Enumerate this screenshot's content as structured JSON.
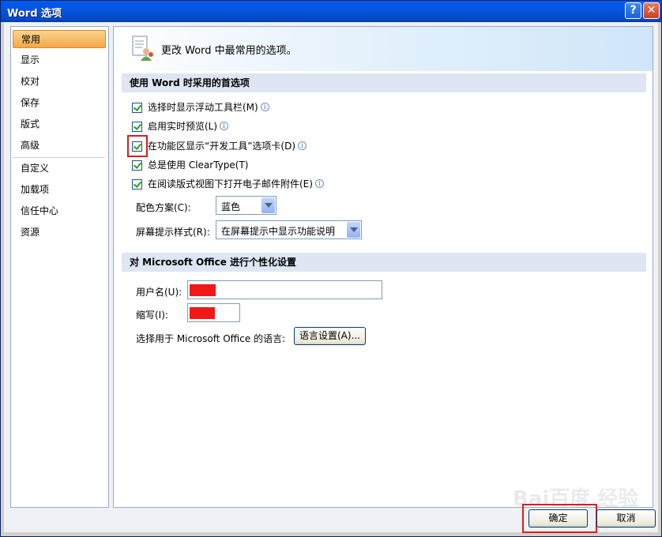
{
  "window": {
    "title": "Word 选项",
    "help_glyph": "?",
    "close_glyph": "✕"
  },
  "nav": {
    "items": [
      {
        "label": "常用",
        "selected": true
      },
      {
        "label": "显示"
      },
      {
        "label": "校对"
      },
      {
        "label": "保存"
      },
      {
        "label": "版式"
      },
      {
        "label": "高级"
      },
      {
        "label": "自定义"
      },
      {
        "label": "加载项"
      },
      {
        "label": "信任中心"
      },
      {
        "label": "资源"
      }
    ]
  },
  "header": {
    "text": "更改 Word 中最常用的选项。",
    "icon": "options-person-icon"
  },
  "section1": {
    "title": "使用 Word 时采用的首选项",
    "checkboxes": [
      {
        "label": "选择时显示浮动工具栏(M)",
        "checked": true
      },
      {
        "label": "启用实时预览(L)",
        "checked": true
      },
      {
        "label": "在功能区显示“开发工具”选项卡(D)",
        "checked": true
      },
      {
        "label": "总是使用 ClearType(T)",
        "checked": true
      },
      {
        "label": "在阅读版式视图下打开电子邮件附件(E)",
        "checked": true
      }
    ],
    "color_scheme_label": "配色方案(C):",
    "color_scheme_value": "蓝色",
    "tooltip_style_label": "屏幕提示样式(R):",
    "tooltip_style_value": "在屏幕提示中显示功能说明"
  },
  "section2": {
    "title": "对 Microsoft Office 进行个性化设置",
    "username_label": "用户名(U):",
    "initials_label": "缩写(I):",
    "language_label": "选择用于 Microsoft Office 的语言:",
    "language_button": "语言设置(A)..."
  },
  "footer": {
    "ok": "确定",
    "cancel": "取消"
  },
  "watermark": "Bai百度 经验",
  "colors": {
    "highlight": "#d81e1e",
    "section_bg": "#dde6f2",
    "nav_selected": "#f4a84c"
  }
}
